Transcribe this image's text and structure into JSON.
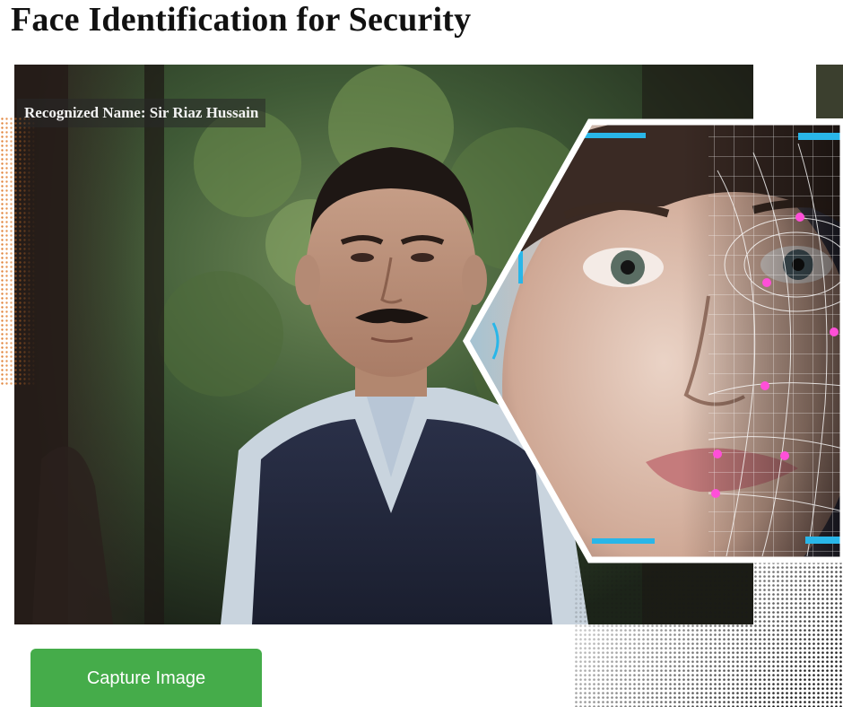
{
  "page": {
    "title": "Face Identification for Security"
  },
  "camera": {
    "recognized_label": "Recognized Name: Sir Riaz Hussain"
  },
  "actions": {
    "capture_label": "Capture Image"
  },
  "colors": {
    "button_bg": "#45ac4a",
    "button_text": "#ffffff",
    "title_text": "#111111",
    "accent_scan": "#29b6e8",
    "landmark_marker": "#ff4fd8",
    "dot_pattern": "#e07a2a"
  },
  "icons": {
    "overlay": "face-scan-hexagon-image"
  }
}
